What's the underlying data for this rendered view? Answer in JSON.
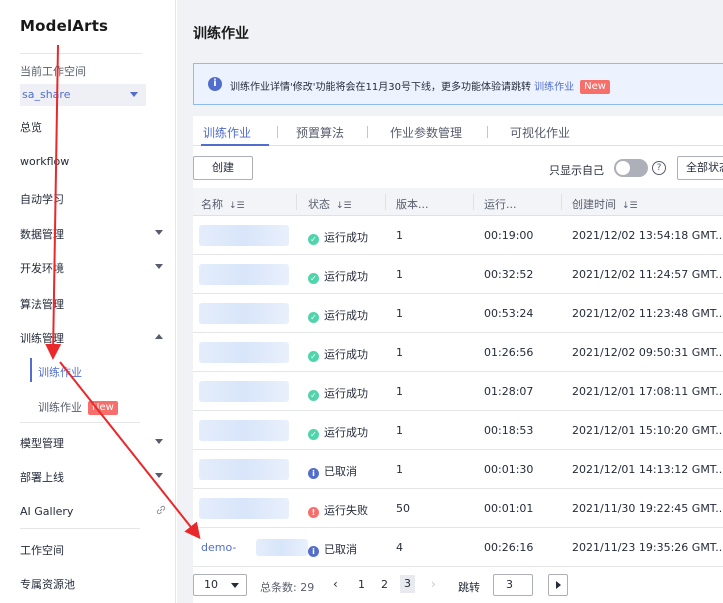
{
  "brand": "ModelArts",
  "workspace": {
    "label": "当前工作空间",
    "value": "sa_share"
  },
  "sidebar": {
    "items": [
      {
        "label": "总览"
      },
      {
        "label": "workflow"
      },
      {
        "label": "自动学习"
      },
      {
        "label": "数据管理"
      },
      {
        "label": "开发环境"
      },
      {
        "label": "算法管理"
      },
      {
        "label": "训练管理"
      },
      {
        "label": "模型管理"
      },
      {
        "label": "部署上线"
      },
      {
        "label": "AI Gallery"
      },
      {
        "label": "工作空间"
      },
      {
        "label": "专属资源池"
      }
    ],
    "sub_items": [
      {
        "label": "训练作业"
      },
      {
        "label": "训练作业",
        "badge": "New"
      }
    ]
  },
  "main": {
    "title": "训练作业",
    "notice": {
      "text": "训练作业详情'修改'功能将会在11月30号下线，更多功能体验请跳转",
      "link": "训练作业",
      "badge": "New"
    },
    "tabs": [
      {
        "label": "训练作业"
      },
      {
        "label": "预置算法"
      },
      {
        "label": "作业参数管理"
      },
      {
        "label": "可视化作业"
      }
    ],
    "toolbar": {
      "create_label": "创建",
      "only_mine_label": "只显示自己",
      "help": "?",
      "status_filter": "全部状态"
    },
    "table": {
      "columns": [
        "名称",
        "状态",
        "版本...",
        "运行...",
        "创建时间"
      ],
      "sort_glyph": "↓☰",
      "rows": [
        {
          "name": "",
          "status": "运行成功",
          "status_type": "ok",
          "version": "1",
          "duration": "00:19:00",
          "created": "2021/12/02 13:54:18 GMT..."
        },
        {
          "name": "",
          "status": "运行成功",
          "status_type": "ok",
          "version": "1",
          "duration": "00:32:52",
          "created": "2021/12/02 11:24:57 GMT..."
        },
        {
          "name": "",
          "status": "运行成功",
          "status_type": "ok",
          "version": "1",
          "duration": "00:53:24",
          "created": "2021/12/02 11:23:48 GMT..."
        },
        {
          "name": "",
          "status": "运行成功",
          "status_type": "ok",
          "version": "1",
          "duration": "01:26:56",
          "created": "2021/12/02 09:50:31 GMT..."
        },
        {
          "name": "",
          "status": "运行成功",
          "status_type": "ok",
          "version": "1",
          "duration": "01:28:07",
          "created": "2021/12/01 17:08:11 GMT..."
        },
        {
          "name": "",
          "status": "运行成功",
          "status_type": "ok",
          "version": "1",
          "duration": "00:18:53",
          "created": "2021/12/01 15:10:20 GMT..."
        },
        {
          "name": "",
          "status": "已取消",
          "status_type": "cancel",
          "version": "1",
          "duration": "00:01:30",
          "created": "2021/12/01 14:13:12 GMT..."
        },
        {
          "name": "",
          "status": "运行失败",
          "status_type": "fail",
          "version": "50",
          "duration": "00:01:01",
          "created": "2021/11/30 19:22:45 GMT..."
        },
        {
          "name": "demo-",
          "status": "已取消",
          "status_type": "cancel",
          "version": "4",
          "duration": "00:26:16",
          "created": "2021/11/23 19:35:26 GMT..."
        }
      ]
    },
    "pagination": {
      "page_size": "10",
      "total_label": "总条数: 29",
      "pages": [
        "1",
        "2",
        "3"
      ],
      "current_page": "3",
      "jump_label": "跳转",
      "jump_value": "3"
    }
  },
  "colors": {
    "accent": "#526ecc",
    "success": "#50d4ab",
    "danger": "#f66f6a",
    "annotation_arrow": "#e8282b"
  },
  "icons": {
    "info": "info-icon",
    "success": "check-circle-icon",
    "fail": "error-circle-icon",
    "external_link": "link-icon"
  }
}
